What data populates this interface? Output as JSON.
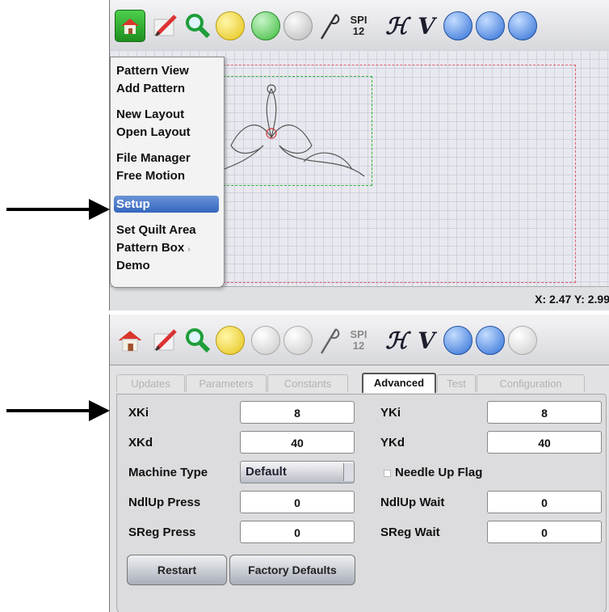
{
  "toolbar": {
    "spi_label": "SPI",
    "spi_value": "12",
    "h_symbol": "ℋ",
    "v_symbol": "V"
  },
  "top_panel": {
    "menu": {
      "items": [
        {
          "label": "Pattern View"
        },
        {
          "label": "Add Pattern"
        },
        {
          "label": "New Layout"
        },
        {
          "label": "Open Layout"
        },
        {
          "label": "File Manager"
        },
        {
          "label": "Free Motion"
        },
        {
          "label": "Setup"
        },
        {
          "label": "Set Quilt Area"
        },
        {
          "label": "Pattern Box"
        },
        {
          "label": "Demo"
        }
      ],
      "selected": "Setup"
    },
    "status": {
      "coords": "X: 2.47 Y: 2.99"
    }
  },
  "setup": {
    "tabs": [
      {
        "label": "Updates"
      },
      {
        "label": "Parameters"
      },
      {
        "label": "Constants"
      },
      {
        "label": "Advanced"
      },
      {
        "label": "Test"
      },
      {
        "label": "Configuration"
      }
    ],
    "active_tab": "Advanced",
    "fields": {
      "xki_label": "XKi",
      "xki_value": "8",
      "yki_label": "YKi",
      "yki_value": "8",
      "xkd_label": "XKd",
      "xkd_value": "40",
      "ykd_label": "YKd",
      "ykd_value": "40",
      "machine_type_label": "Machine Type",
      "machine_type_value": "Default",
      "needle_up_flag_label": "Needle Up Flag",
      "ndlup_press_label": "NdlUp Press",
      "ndlup_press_value": "0",
      "ndlup_wait_label": "NdlUp Wait",
      "ndlup_wait_value": "0",
      "sreg_press_label": "SReg Press",
      "sreg_press_value": "0",
      "sreg_wait_label": "SReg Wait",
      "sreg_wait_value": "0"
    },
    "buttons": {
      "restart": "Restart",
      "factory_defaults": "Factory Defaults"
    }
  },
  "colors": {
    "menu_highlight": "#3466be",
    "grid_background": "#e8e9ef",
    "pattern_boundary": "#2fb52f",
    "quilt_area_boundary": "#e05a6a"
  }
}
